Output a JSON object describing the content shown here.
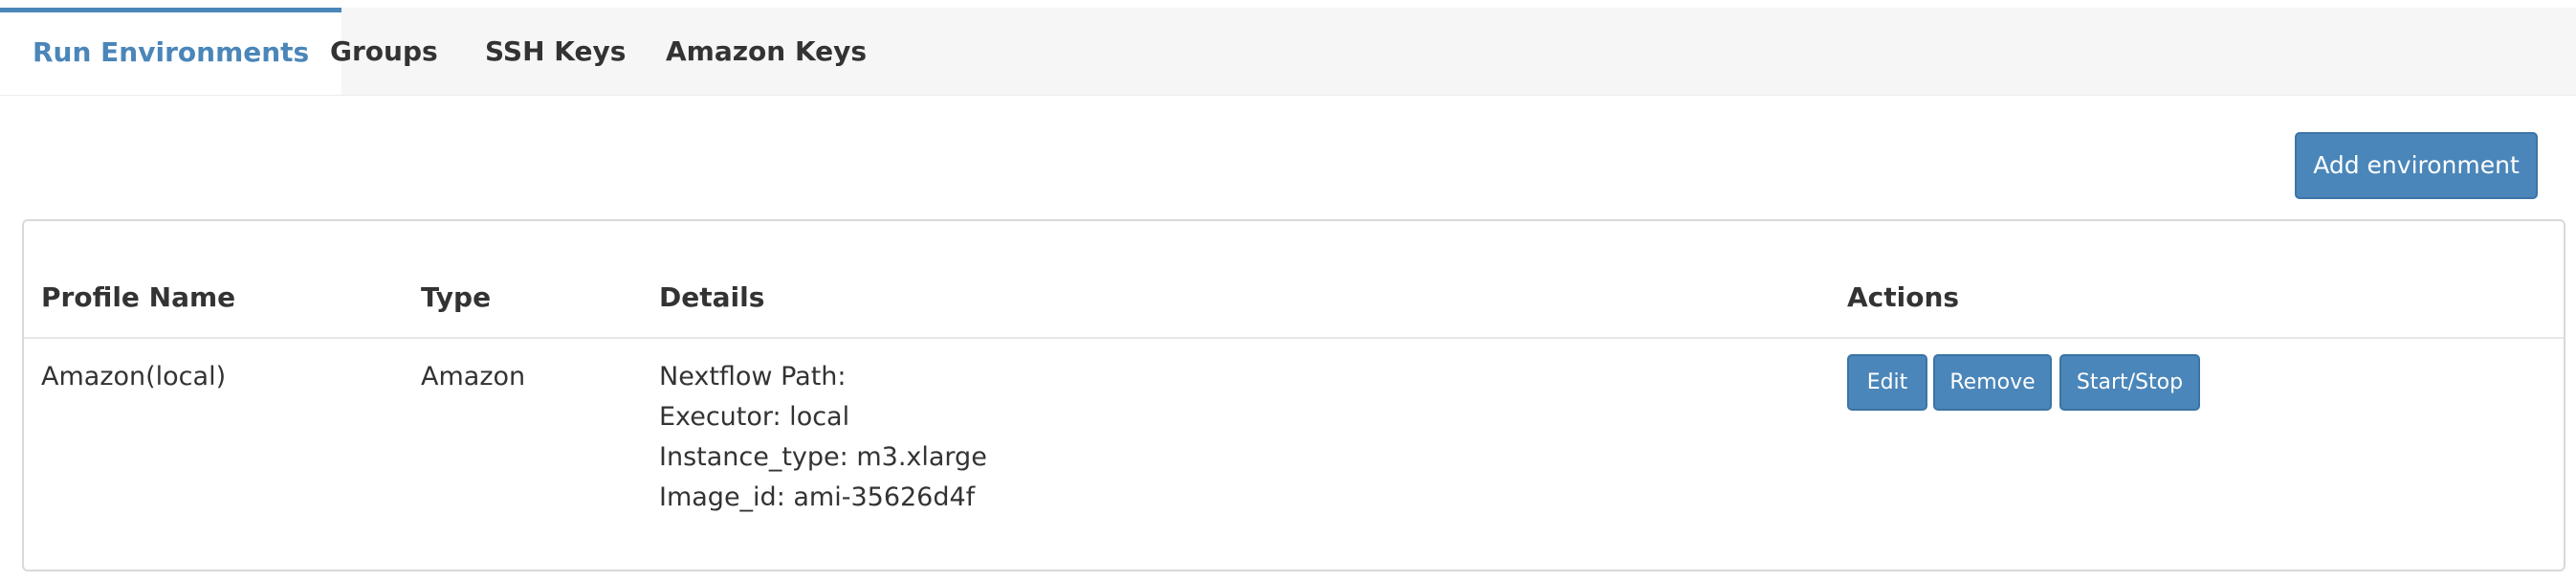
{
  "tabs": [
    {
      "label": "Run Environments",
      "active": true
    },
    {
      "label": "Groups",
      "active": false
    },
    {
      "label": "SSH Keys",
      "active": false
    },
    {
      "label": "Amazon Keys",
      "active": false
    }
  ],
  "toolbar": {
    "add_label": "Add environment"
  },
  "table": {
    "headers": {
      "profile": "Profile Name",
      "type": "Type",
      "details": "Details",
      "actions": "Actions"
    },
    "rows": [
      {
        "profile": "Amazon(local)",
        "type": "Amazon",
        "details": [
          "Nextflow Path:",
          "Executor: local",
          "Instance_type: m3.xlarge",
          "Image_id: ami-35626d4f"
        ],
        "actions": {
          "edit": "Edit",
          "remove": "Remove",
          "startstop": "Start/Stop"
        }
      }
    ]
  },
  "colors": {
    "accent": "#4a86b9",
    "tab_bar_bg": "#f6f6f6"
  }
}
